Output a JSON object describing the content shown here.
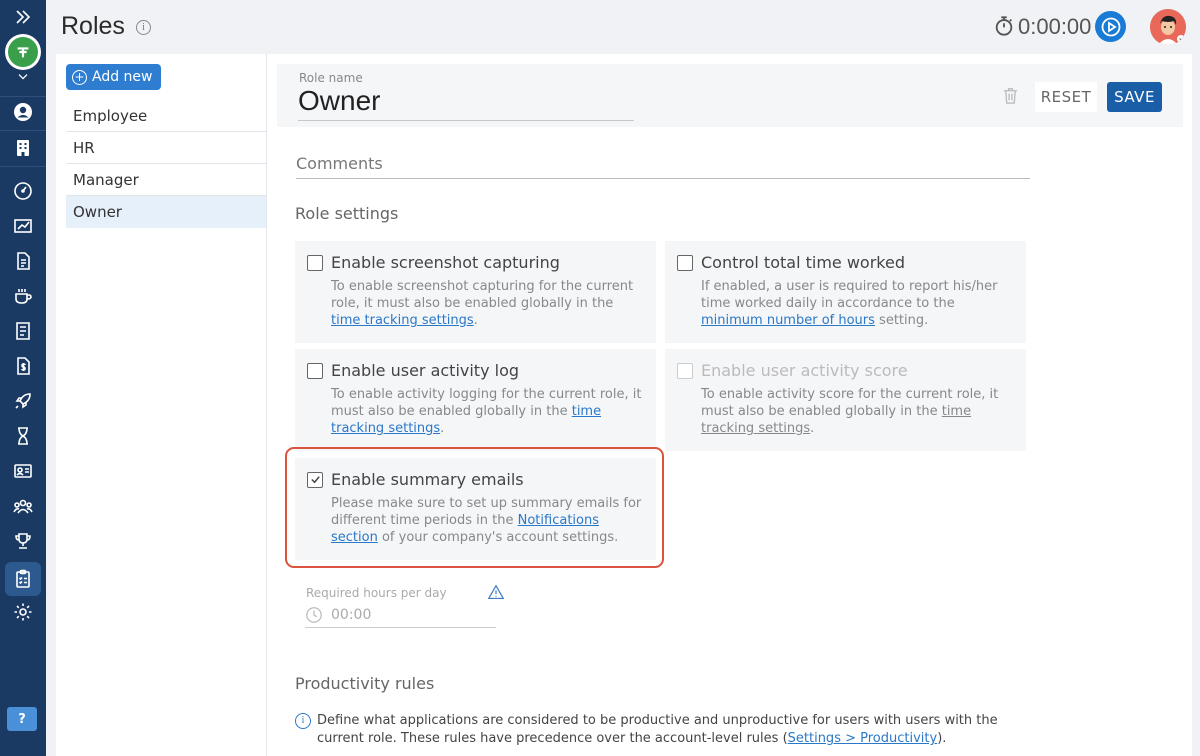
{
  "header": {
    "title": "Roles",
    "timer": "0:00:00"
  },
  "role_list": {
    "add_new_label": "Add new",
    "items": [
      {
        "label": "Employee"
      },
      {
        "label": "HR"
      },
      {
        "label": "Manager"
      },
      {
        "label": "Owner",
        "selected": true
      }
    ]
  },
  "role_editor": {
    "role_name_label": "Role name",
    "role_name_value": "Owner",
    "reset_label": "RESET",
    "save_label": "SAVE",
    "comments_placeholder": "Comments",
    "role_settings_title": "Role settings",
    "settings": [
      {
        "title": "Enable screenshot capturing",
        "checked": false,
        "disabled": false,
        "desc_before": "To enable screenshot capturing for the current role, it must also be enabled globally in the ",
        "link": "time tracking settings",
        "desc_after": "."
      },
      {
        "title": "Control total time worked",
        "checked": false,
        "disabled": false,
        "desc_before": "If enabled, a user is required to report his/her time worked daily in accordance to the ",
        "link": "minimum number of hours",
        "desc_after": " setting."
      },
      {
        "title": "Enable user activity log",
        "checked": false,
        "disabled": false,
        "desc_before": "To enable activity logging for the current role, it must also be enabled globally in the ",
        "link": "time tracking settings",
        "desc_after": "."
      },
      {
        "title": "Enable user activity score",
        "checked": false,
        "disabled": true,
        "desc_before": "To enable activity score for the current role, it must also be enabled globally in the ",
        "link": "time tracking settings",
        "desc_after": "."
      },
      {
        "title": "Enable summary emails",
        "checked": true,
        "disabled": false,
        "desc_before": "Please make sure to set up summary emails for different time periods in the ",
        "link": "Notifications section",
        "desc_after": " of your company's account settings."
      }
    ],
    "required_hours_label": "Required hours per day",
    "required_hours_value": "00:00",
    "productivity_title": "Productivity rules",
    "productivity_note_before": "Define what applications are considered to be productive and unproductive for users with users with the current role. These rules have precedence over the account-level rules (",
    "productivity_note_link": "Settings > Productivity",
    "productivity_note_after": ")."
  },
  "colors": {
    "rail": "#1b3a63",
    "accent": "#1a5ea8",
    "highlight": "#d9533f",
    "link": "#2a78c8"
  }
}
